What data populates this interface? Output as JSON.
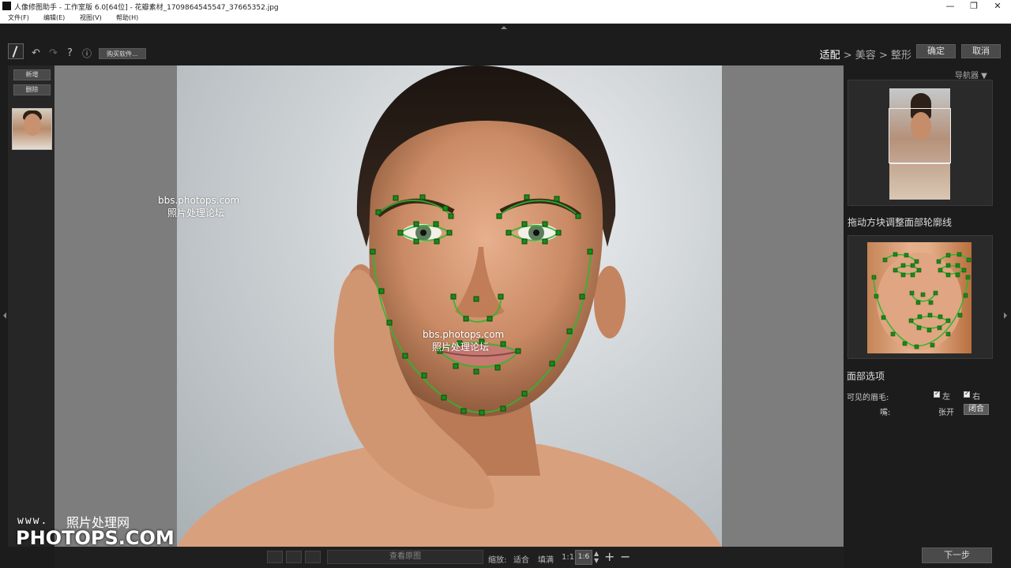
{
  "window": {
    "title": "人像修图助手 - 工作室版 6.0[64位] - 花瓣素材_1709864545547_37665352.jpg",
    "controls": [
      "—",
      "❐",
      "✕"
    ]
  },
  "menu": [
    "文件(F)",
    "编辑(E)",
    "视图(V)",
    "帮助(H)"
  ],
  "toolbar": {
    "help": "?",
    "info": "ⓘ",
    "buy": "购买软件..."
  },
  "workflow": {
    "step1": "适配",
    "step2": "美容",
    "step3": "整形",
    "sep": " > ",
    "confirm": "确定",
    "cancel": "取消"
  },
  "left": {
    "add": "新增",
    "delete": "删除"
  },
  "watermarks": {
    "url": "bbs.photops.com",
    "cn": "照片处理论坛"
  },
  "bottom": {
    "view_original": "查看原图",
    "zoom_label": "缩放:",
    "fit": "适合",
    "fill": "填满",
    "one_to_one": "1:1",
    "zoom_value": "1:6"
  },
  "right": {
    "navigator": "导航器 ▼",
    "contour_title": "拖动方块调整面部轮廓线",
    "face_options": "面部选项",
    "visible_brows": "可见的眉毛:",
    "left": "左",
    "right": "右",
    "mouth": "嘴:",
    "open": "张开",
    "closed": "闭合",
    "next": "下一步"
  },
  "corner": {
    "www": "www.",
    "cn": "照片处理网",
    "brand": "PHOTOPS.COM"
  }
}
